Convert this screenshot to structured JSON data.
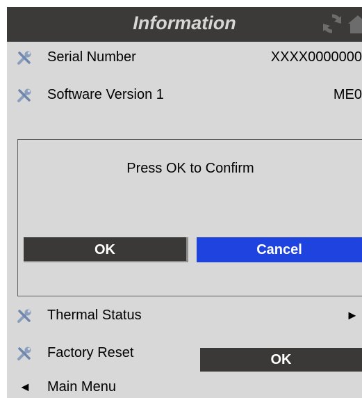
{
  "header": {
    "title": "Information"
  },
  "rows": {
    "serial": {
      "label": "Serial Number",
      "value": "XXXX0000000"
    },
    "software": {
      "label": "Software Version 1",
      "value": "ME0"
    },
    "thermal": {
      "label": "Thermal Status",
      "arrow": "►"
    },
    "factory_reset": {
      "label": "Factory Reset",
      "button": "OK"
    },
    "main_menu": {
      "label": "Main Menu",
      "arrow": "◄"
    }
  },
  "dialog": {
    "message": "Press OK to Confirm",
    "ok_label": "OK",
    "cancel_label": "Cancel"
  },
  "colors": {
    "header_bg": "#3c3a39",
    "screen_bg": "#d8d8d8",
    "cancel_bg": "#1f43df",
    "ok_bg": "#3b3938"
  },
  "icons": [
    "refresh-icon",
    "home-icon",
    "tools-icon"
  ]
}
